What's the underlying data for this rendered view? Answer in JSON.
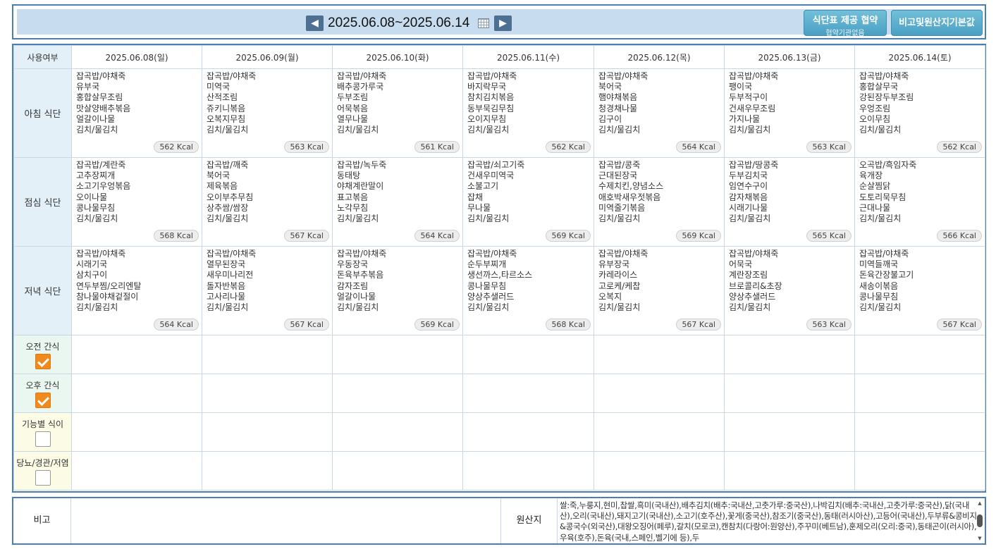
{
  "header": {
    "prev_icon": "chevron-left-icon",
    "next_icon": "chevron-right-icon",
    "date_range": "2025.06.08~2025.06.14",
    "calendar_icon": "calendar-icon",
    "provide_button": {
      "label": "식단표 제공 협약",
      "sub": "협약기관없음"
    },
    "origin_button": "비고및원산지기본값"
  },
  "table": {
    "usage_header": "사용여부",
    "days": [
      {
        "label": "2025.06.08(일)",
        "type": "sun"
      },
      {
        "label": "2025.06.09(월)",
        "type": "weekday"
      },
      {
        "label": "2025.06.10(화)",
        "type": "weekday"
      },
      {
        "label": "2025.06.11(수)",
        "type": "weekday"
      },
      {
        "label": "2025.06.12(목)",
        "type": "weekday"
      },
      {
        "label": "2025.06.13(금)",
        "type": "weekday"
      },
      {
        "label": "2025.06.14(토)",
        "type": "sat"
      }
    ],
    "meals": [
      {
        "label": "아침 식단",
        "cells": [
          {
            "items": [
              "잡곡밥/야채죽",
              "유부국",
              "홍합살무조림",
              "맛살양배추볶음",
              "얼갈이나물",
              "김치/물김치"
            ],
            "kcal": "562 Kcal"
          },
          {
            "items": [
              "잡곡밥/야채죽",
              "미역국",
              "산적조림",
              "쥬키니볶음",
              "오복지무침",
              "김치/물김치"
            ],
            "kcal": "563 Kcal"
          },
          {
            "items": [
              "잡곡밥/야채죽",
              "배추콩가루국",
              "두부조림",
              "어묵볶음",
              "열무나물",
              "김치/물김치"
            ],
            "kcal": "561 Kcal"
          },
          {
            "items": [
              "잡곡밥/야채죽",
              "바지락무국",
              "참치김치볶음",
              "동부묵김무침",
              "오이지무침",
              "김치/물김치"
            ],
            "kcal": "562 Kcal"
          },
          {
            "items": [
              "잡곡밥/야채죽",
              "북어국",
              "햄야채볶음",
              "청경채나물",
              "김구이",
              "김치/물김치"
            ],
            "kcal": "564 Kcal"
          },
          {
            "items": [
              "잡곡밥/야채죽",
              "팽이국",
              "두부적구이",
              "건새우무조림",
              "가지나물",
              "김치/물김치"
            ],
            "kcal": "563 Kcal"
          },
          {
            "items": [
              "잡곡밥/야채죽",
              "홍합살무국",
              "강된장두부조림",
              "우엉조림",
              "오이무침",
              "김치/물김치"
            ],
            "kcal": "562 Kcal"
          }
        ]
      },
      {
        "label": "점심 식단",
        "cells": [
          {
            "items": [
              "잡곡밥/계란죽",
              "고추장찌개",
              "소고기우엉볶음",
              "오이나물",
              "콩나물무침",
              "김치/물김치"
            ],
            "kcal": "568 Kcal"
          },
          {
            "items": [
              "잡곡밥/깨죽",
              "북어국",
              "제육볶음",
              "오이부추무침",
              "상추쌈/쌈장",
              "김치/물김치"
            ],
            "kcal": "567 Kcal"
          },
          {
            "items": [
              "잡곡밥/녹두죽",
              "동태탕",
              "야채계란말이",
              "표고볶음",
              "노각무침",
              "김치/물김치"
            ],
            "kcal": "564 Kcal"
          },
          {
            "items": [
              "잡곡밥/쇠고기죽",
              "건새우미역국",
              "소불고기",
              "잡채",
              "무나물",
              "김치/물김치"
            ],
            "kcal": "569 Kcal"
          },
          {
            "items": [
              "잡곡밥/콩죽",
              "근대된장국",
              "수제치킨,양념소스",
              "애호박새우젓볶음",
              "미역줄기볶음",
              "김치/물김치"
            ],
            "kcal": "569 Kcal"
          },
          {
            "items": [
              "잡곡밥/땅콩죽",
              "두부김치국",
              "임연수구이",
              "감자채볶음",
              "시래기나물",
              "김치/물김치"
            ],
            "kcal": "565 Kcal"
          },
          {
            "items": [
              "오곡밥/흑임자죽",
              "육개장",
              "순살찜닭",
              "도토리묵무침",
              "근대나물",
              "김치/물김치"
            ],
            "kcal": "566 Kcal"
          }
        ]
      },
      {
        "label": "저녁 식단",
        "cells": [
          {
            "items": [
              "잡곡밥/야채죽",
              "시래기국",
              "삼치구이",
              "연두부찜/오리엔탈",
              "참나물야채겉절이",
              "김치/물김치"
            ],
            "kcal": "564 Kcal"
          },
          {
            "items": [
              "잡곡밥/야채죽",
              "열무된장국",
              "새우미나리전",
              "돌자반볶음",
              "고사리나물",
              "김치/물김치"
            ],
            "kcal": "567 Kcal"
          },
          {
            "items": [
              "잡곡밥/야채죽",
              "우동장국",
              "돈육부추볶음",
              "감자조림",
              "얼갈이나물",
              "김치/물김치"
            ],
            "kcal": "569 Kcal"
          },
          {
            "items": [
              "잡곡밥/야채죽",
              "순두부찌개",
              "생선까스,타르소스",
              "콩나물무침",
              "양상추샐러드",
              "김치/물김치"
            ],
            "kcal": "568 Kcal"
          },
          {
            "items": [
              "잡곡밥/야채죽",
              "유부장국",
              "카레라이스",
              "고로케/케찹",
              "오복지",
              "김치/물김치"
            ],
            "kcal": "567 Kcal"
          },
          {
            "items": [
              "잡곡밥/야채죽",
              "어묵국",
              "계란장조림",
              "브로콜리&초장",
              "양상추샐러드",
              "김치/물김치"
            ],
            "kcal": "563 Kcal"
          },
          {
            "items": [
              "잡곡밥/야채죽",
              "미역들깨국",
              "돈육간장불고기",
              "새송이볶음",
              "콩나물무침",
              "김치/물김치"
            ],
            "kcal": "567 Kcal"
          }
        ]
      }
    ],
    "extras": [
      {
        "label": "오전 간식",
        "checked": true,
        "kind": "snack"
      },
      {
        "label": "오후 간식",
        "checked": true,
        "kind": "snack"
      },
      {
        "label": "기능별 식이",
        "checked": false,
        "kind": "func"
      },
      {
        "label": "당뇨/경관/저염",
        "checked": false,
        "kind": "func"
      }
    ]
  },
  "footer": {
    "note_label": "비고",
    "note_value": "",
    "origin_label": "원산지",
    "origin_text": "쌀:죽,누룽지,현미,찹쌀,흑미(국내산),배추김치(배추:국내산,고춧가루:중국산),나박김치(배추:국내산,고춧가루:중국산),닭(국내산),오리(국내산),돼지고기(국내산),소고기(호주산),꽃게(중국산),참조기(중국산),동태(러시아산),고등어(국내산),두부류&콩비지&콩국수(외국산),대왕오징어(페루),갈치(모로코),캔참치(다랑어:원양산),주꾸미(베트남),훈제오리(오리:중국),동태곤이(러시아),우육(호주),돈육(국내,스페인,벨기에 등),두"
  }
}
